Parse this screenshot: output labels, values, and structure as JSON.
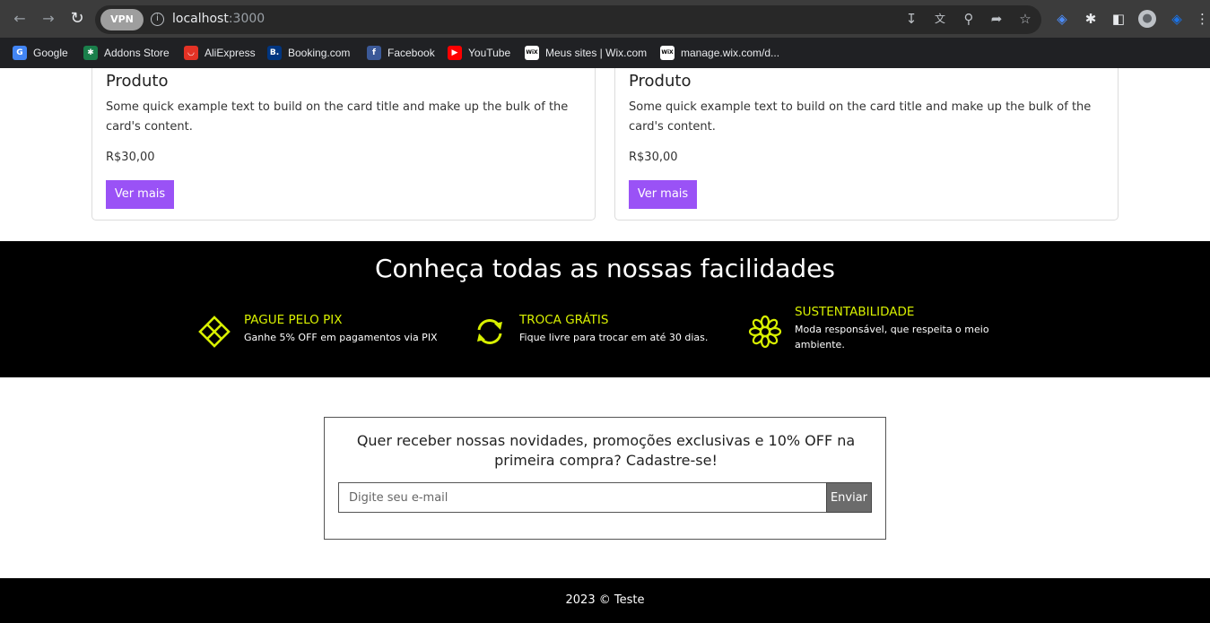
{
  "browser": {
    "url_host": "localhost",
    "url_port": ":3000",
    "vpn_label": "VPN",
    "bookmarks": [
      {
        "label": "Google",
        "icon": "google-icon",
        "color": "#4285f4",
        "glyph": "G"
      },
      {
        "label": "Addons Store",
        "icon": "addons-store-icon",
        "color": "#1a7f4b",
        "glyph": "✱"
      },
      {
        "label": "AliExpress",
        "icon": "aliexpress-icon",
        "color": "#e43225",
        "glyph": "◡"
      },
      {
        "label": "Booking.com",
        "icon": "booking-icon",
        "color": "#003580",
        "glyph": "B."
      },
      {
        "label": "Facebook",
        "icon": "facebook-icon",
        "color": "#3b5998",
        "glyph": "f"
      },
      {
        "label": "YouTube",
        "icon": "youtube-icon",
        "color": "#ff0000",
        "glyph": "▶"
      },
      {
        "label": "Meus sites | Wix.com",
        "icon": "wix-icon",
        "color": "#ffffff",
        "glyph": "WiX"
      },
      {
        "label": "manage.wix.com/d...",
        "icon": "wix-icon",
        "color": "#ffffff",
        "glyph": "WiX"
      }
    ]
  },
  "products": [
    {
      "title": "Produto",
      "text": "Some quick example text to build on the card title and make up the bulk of the card's content.",
      "price": "R$30,00",
      "button": "Ver mais"
    },
    {
      "title": "Produto",
      "text": "Some quick example text to build on the card title and make up the bulk of the card's content.",
      "price": "R$30,00",
      "button": "Ver mais"
    }
  ],
  "features": {
    "title": "Conheça todas as nossas facilidades",
    "accent_color": "#d8f000",
    "items": [
      {
        "icon": "pix-icon",
        "title": "PAGUE PELO PIX",
        "desc": "Ganhe 5% OFF em pagamentos via PIX"
      },
      {
        "icon": "exchange-icon",
        "title": "TROCA GRÁTIS",
        "desc": "Fique livre para trocar em até 30 dias."
      },
      {
        "icon": "flower-icon",
        "title": "SUSTENTABILIDADE",
        "desc": "Moda responsável, que respeita o meio ambiente."
      }
    ]
  },
  "newsletter": {
    "title": "Quer receber nossas novidades, promoções exclusivas e 10% OFF na primeira compra? Cadastre-se!",
    "placeholder": "Digite seu e-mail",
    "button": "Enviar"
  },
  "footer": {
    "text": "2023 © Teste"
  }
}
